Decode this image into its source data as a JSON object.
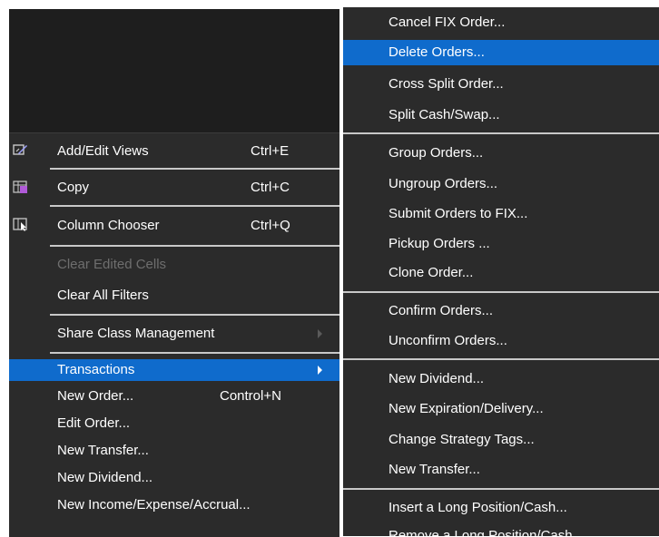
{
  "left_menu": {
    "items": [
      {
        "label": "Add/Edit Views",
        "shortcut": "Ctrl+E",
        "icon": "edit-views-icon"
      },
      {
        "label": "Copy",
        "shortcut": "Ctrl+C",
        "icon": "copy-icon"
      },
      {
        "label": "Column Chooser",
        "shortcut": "Ctrl+Q",
        "icon": "column-chooser-icon"
      },
      {
        "label": "Clear Edited Cells",
        "disabled": true
      },
      {
        "label": "Clear All Filters"
      },
      {
        "label": "Share Class Management",
        "submenu": true
      },
      {
        "label": "Transactions",
        "submenu": true,
        "active": true
      },
      {
        "label": "New Order...",
        "shortcut": "Control+N"
      },
      {
        "label": "Edit Order..."
      },
      {
        "label": "New Transfer..."
      },
      {
        "label": "New Dividend..."
      },
      {
        "label": "New Income/Expense/Accrual..."
      }
    ]
  },
  "right_menu": {
    "items": [
      {
        "label": "Cancel FIX Order..."
      },
      {
        "label": "Delete Orders...",
        "active": true
      },
      {
        "label": "Cross Split Order..."
      },
      {
        "label": "Split Cash/Swap..."
      },
      {
        "label": "Group Orders..."
      },
      {
        "label": "Ungroup Orders..."
      },
      {
        "label": "Submit Orders to FIX..."
      },
      {
        "label": "Pickup Orders ..."
      },
      {
        "label": "Clone Order..."
      },
      {
        "label": "Confirm Orders..."
      },
      {
        "label": "Unconfirm Orders..."
      },
      {
        "label": "New Dividend..."
      },
      {
        "label": "New Expiration/Delivery..."
      },
      {
        "label": "Change Strategy Tags..."
      },
      {
        "label": "New Transfer..."
      },
      {
        "label": "Insert a Long Position/Cash..."
      },
      {
        "label": "Remove a Long Position/Cash..."
      }
    ]
  },
  "colors": {
    "menu_bg": "#2b2b2b",
    "highlight": "#0f6bcc",
    "separator": "#c8c8c8",
    "text": "#ffffff",
    "disabled_text": "#6e6e6e"
  }
}
